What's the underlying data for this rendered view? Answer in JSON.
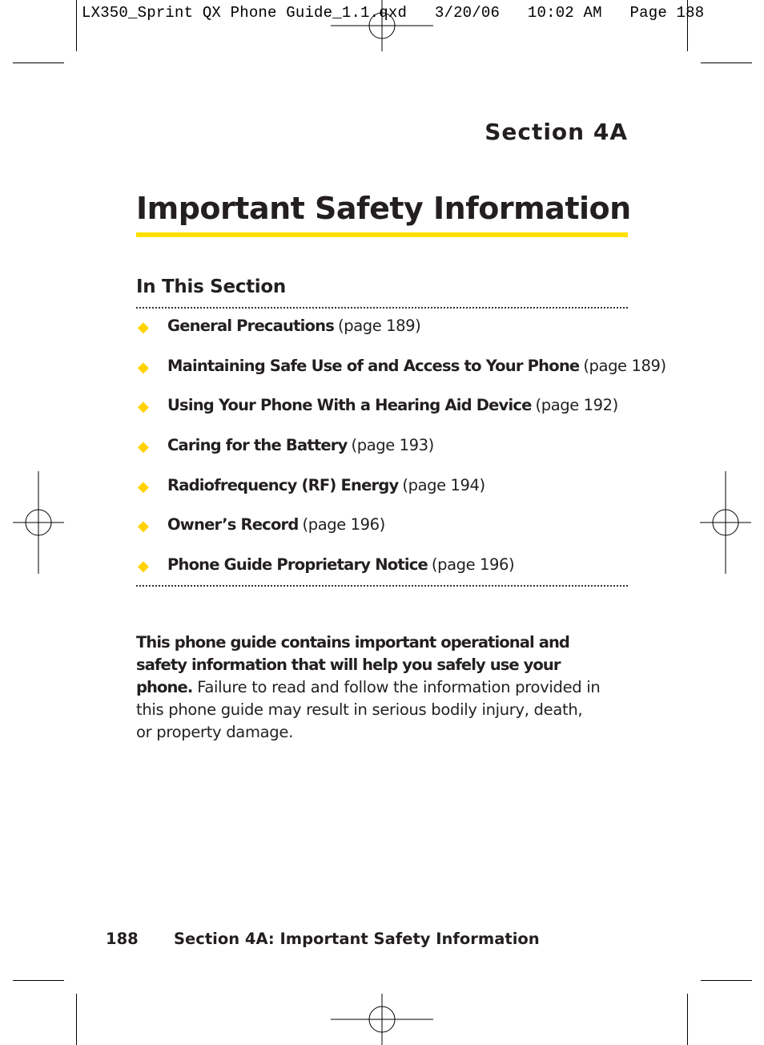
{
  "slug": "LX350_Sprint QX Phone Guide_1.1.qxd   3/20/06   10:02 AM   Page 188",
  "section_label": "Section 4A",
  "title": "Important Safety Information",
  "in_this_section": "In This Section",
  "toc": [
    {
      "name": "General Precautions",
      "page": "(page 189)"
    },
    {
      "name": "Maintaining Safe Use of and Access to Your Phone",
      "page": "(page 189)"
    },
    {
      "name": "Using Your Phone With a Hearing Aid Device",
      "page": "(page 192)"
    },
    {
      "name": "Caring for the Battery",
      "page": "(page 193)"
    },
    {
      "name": "Radiofrequency (RF) Energy",
      "page": "(page 194)"
    },
    {
      "name": "Owner’s Record",
      "page": "(page 196)"
    },
    {
      "name": "Phone Guide Proprietary Notice",
      "page": "(page 196)"
    }
  ],
  "bullet_icon": "yellow-diamond",
  "intro": {
    "bold": "This phone guide contains important operational and safety information that will help you safely use your phone.",
    "normal": " Failure to read and follow the information provided in this phone guide may result in serious bodily injury, death, or property damage."
  },
  "footer": {
    "page_number": "188",
    "running_title": "Section 4A: Important Safety Information"
  },
  "colors": {
    "accent": "#ffe000",
    "text": "#231f20"
  }
}
